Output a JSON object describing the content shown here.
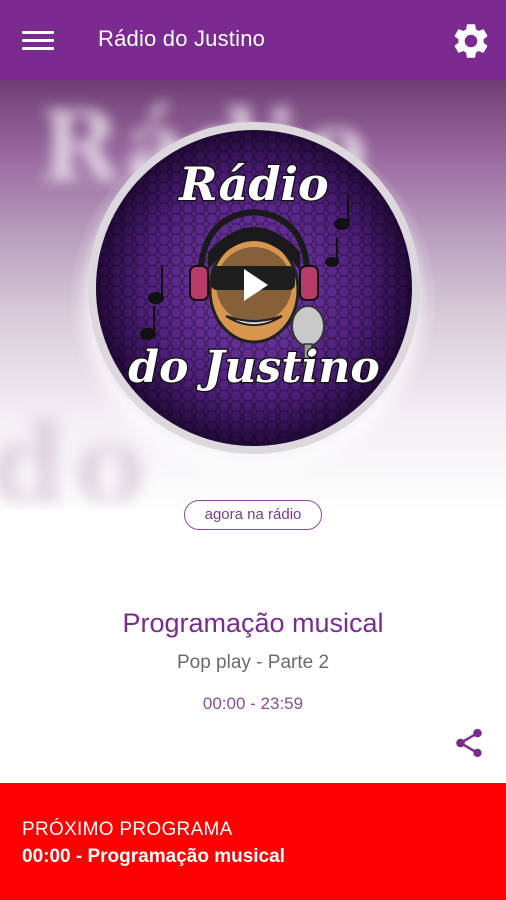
{
  "appbar": {
    "title": "Rádio do Justino",
    "menu_icon": "hamburger-menu-icon",
    "settings_icon": "gear-icon",
    "color": "#7b2a8f"
  },
  "hero": {
    "logo_line1": "Rádio",
    "logo_line2": "do Justino",
    "background_text_top": "Rádio",
    "background_text_bottom": "do Justino",
    "play_icon": "play-icon"
  },
  "now_playing": {
    "pill_label": "agora na rádio",
    "program_title": "Programação musical",
    "program_subtitle": "Pop play - Parte 2",
    "program_time": "00:00 - 23:59",
    "share_icon": "share-icon"
  },
  "next_program": {
    "label": "PRÓXIMO PROGRAMA",
    "value": "00:00 - Programação musical",
    "background": "#ff0000"
  }
}
